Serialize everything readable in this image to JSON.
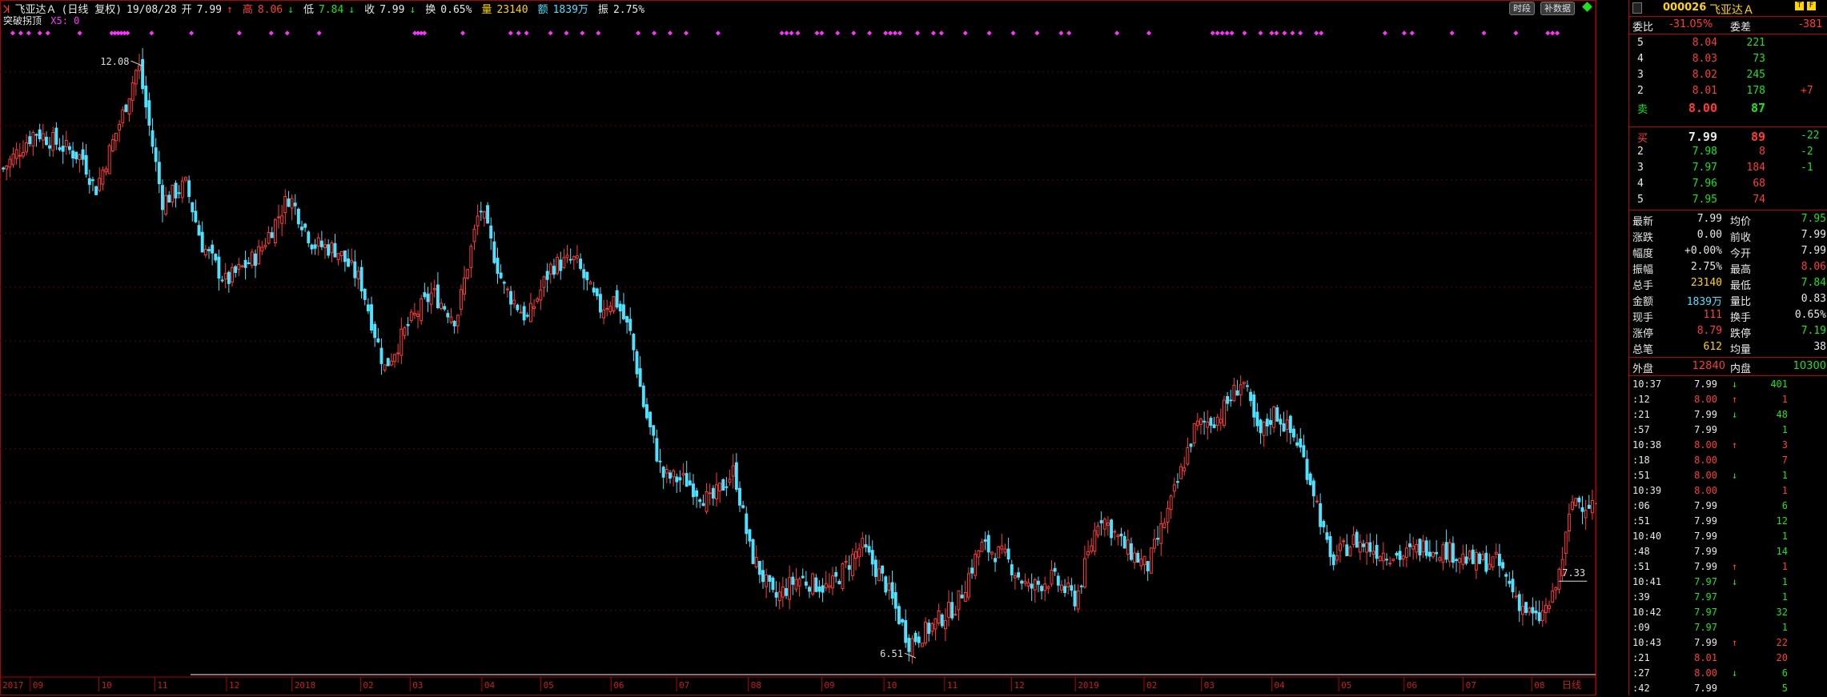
{
  "header": {
    "stock_name": "飞亚达Ａ",
    "period": "(日线 复权)",
    "date": "19/08/28",
    "open_label": "开",
    "open": "7.99",
    "open_arrow": "↑",
    "high_label": "高",
    "high": "8.06",
    "high_arrow": "↓",
    "low_label": "低",
    "low": "7.84",
    "low_arrow": "↓",
    "close_label": "收",
    "close": "7.99",
    "close_arrow": "↓",
    "turnover_label": "换",
    "turnover": "0.65%",
    "volume_label": "量",
    "volume": "23140",
    "amount_label": "额",
    "amount": "1839万",
    "amplitude_label": "振",
    "amplitude": "2.75%",
    "buttons": [
      "时段",
      "补数据"
    ],
    "indicator_name": "突破拐顶",
    "indicator_value": "X5: 0"
  },
  "chart_data": {
    "type": "candlestick",
    "y_ticks": [
      "12.00",
      "11.50",
      "11.00",
      "10.50",
      "10.00",
      "9.50",
      "9.00",
      "8.50",
      "8.00",
      "7.50",
      "7.00"
    ],
    "y_range": [
      6.44,
      12.4
    ],
    "x_ticks": [
      {
        "label": "2017",
        "x": 0
      },
      {
        "label": "09",
        "x": 0.019
      },
      {
        "label": "10",
        "x": 0.062
      },
      {
        "label": "11",
        "x": 0.097
      },
      {
        "label": "12",
        "x": 0.142
      },
      {
        "label": "2018",
        "x": 0.183
      },
      {
        "label": "02",
        "x": 0.226
      },
      {
        "label": "03",
        "x": 0.257
      },
      {
        "label": "04",
        "x": 0.302
      },
      {
        "label": "05",
        "x": 0.339
      },
      {
        "label": "06",
        "x": 0.383
      },
      {
        "label": "07",
        "x": 0.424
      },
      {
        "label": "08",
        "x": 0.469
      },
      {
        "label": "09",
        "x": 0.515
      },
      {
        "label": "10",
        "x": 0.554
      },
      {
        "label": "11",
        "x": 0.592
      },
      {
        "label": "12",
        "x": 0.634
      },
      {
        "label": "2019",
        "x": 0.674
      },
      {
        "label": "02",
        "x": 0.717
      },
      {
        "label": "03",
        "x": 0.753
      },
      {
        "label": "04",
        "x": 0.797
      },
      {
        "label": "05",
        "x": 0.839
      },
      {
        "label": "06",
        "x": 0.88
      },
      {
        "label": "07",
        "x": 0.917
      },
      {
        "label": "08",
        "x": 0.96
      }
    ],
    "x_axis_right_label": "日线",
    "anchors": [
      {
        "x": 0,
        "y": 11.1
      },
      {
        "x": 0.02,
        "y": 11.45
      },
      {
        "x": 0.05,
        "y": 11.2
      },
      {
        "x": 0.058,
        "y": 10.9
      },
      {
        "x": 0.075,
        "y": 11.6
      },
      {
        "x": 0.085,
        "y": 12.08
      },
      {
        "x": 0.093,
        "y": 11.4
      },
      {
        "x": 0.1,
        "y": 10.8
      },
      {
        "x": 0.115,
        "y": 10.95
      },
      {
        "x": 0.125,
        "y": 10.4
      },
      {
        "x": 0.14,
        "y": 10.05
      },
      {
        "x": 0.16,
        "y": 10.3
      },
      {
        "x": 0.18,
        "y": 10.85
      },
      {
        "x": 0.195,
        "y": 10.4
      },
      {
        "x": 0.21,
        "y": 10.35
      },
      {
        "x": 0.225,
        "y": 10.05
      },
      {
        "x": 0.24,
        "y": 9.25
      },
      {
        "x": 0.255,
        "y": 9.65
      },
      {
        "x": 0.27,
        "y": 9.95
      },
      {
        "x": 0.285,
        "y": 9.7
      },
      {
        "x": 0.3,
        "y": 10.75
      },
      {
        "x": 0.315,
        "y": 10.0
      },
      {
        "x": 0.33,
        "y": 9.7
      },
      {
        "x": 0.345,
        "y": 10.2
      },
      {
        "x": 0.36,
        "y": 10.25
      },
      {
        "x": 0.375,
        "y": 9.8
      },
      {
        "x": 0.385,
        "y": 9.9
      },
      {
        "x": 0.395,
        "y": 9.55
      },
      {
        "x": 0.403,
        "y": 8.9
      },
      {
        "x": 0.415,
        "y": 8.25
      },
      {
        "x": 0.43,
        "y": 8.2
      },
      {
        "x": 0.445,
        "y": 8.0
      },
      {
        "x": 0.46,
        "y": 8.3
      },
      {
        "x": 0.47,
        "y": 7.55
      },
      {
        "x": 0.485,
        "y": 7.1
      },
      {
        "x": 0.5,
        "y": 7.3
      },
      {
        "x": 0.52,
        "y": 7.2
      },
      {
        "x": 0.54,
        "y": 7.6
      },
      {
        "x": 0.555,
        "y": 7.25
      },
      {
        "x": 0.57,
        "y": 6.7
      },
      {
        "x": 0.58,
        "y": 6.8
      },
      {
        "x": 0.6,
        "y": 7.05
      },
      {
        "x": 0.615,
        "y": 7.6
      },
      {
        "x": 0.63,
        "y": 7.5
      },
      {
        "x": 0.645,
        "y": 7.2
      },
      {
        "x": 0.66,
        "y": 7.3
      },
      {
        "x": 0.675,
        "y": 7.1
      },
      {
        "x": 0.69,
        "y": 7.9
      },
      {
        "x": 0.705,
        "y": 7.6
      },
      {
        "x": 0.72,
        "y": 7.4
      },
      {
        "x": 0.735,
        "y": 8.0
      },
      {
        "x": 0.75,
        "y": 8.7
      },
      {
        "x": 0.765,
        "y": 8.8
      },
      {
        "x": 0.78,
        "y": 9.15
      },
      {
        "x": 0.79,
        "y": 8.6
      },
      {
        "x": 0.8,
        "y": 8.85
      },
      {
        "x": 0.815,
        "y": 8.55
      },
      {
        "x": 0.825,
        "y": 8.1
      },
      {
        "x": 0.835,
        "y": 7.45
      },
      {
        "x": 0.85,
        "y": 7.65
      },
      {
        "x": 0.865,
        "y": 7.55
      },
      {
        "x": 0.88,
        "y": 7.5
      },
      {
        "x": 0.895,
        "y": 7.6
      },
      {
        "x": 0.91,
        "y": 7.55
      },
      {
        "x": 0.925,
        "y": 7.45
      },
      {
        "x": 0.94,
        "y": 7.45
      },
      {
        "x": 0.955,
        "y": 7.05
      },
      {
        "x": 0.965,
        "y": 6.9
      },
      {
        "x": 0.975,
        "y": 7.1
      },
      {
        "x": 0.98,
        "y": 7.4
      },
      {
        "x": 0.988,
        "y": 8.05
      },
      {
        "x": 0.995,
        "y": 7.99
      }
    ],
    "annotations": [
      {
        "text": "12.08",
        "x": 0.082,
        "y": 12.08,
        "align": "right"
      },
      {
        "text": "6.51",
        "x": 0.567,
        "y": 6.58,
        "align": "right"
      },
      {
        "text": "7.33",
        "x": 0.977,
        "y": 7.33,
        "align": "left"
      }
    ],
    "last_price_marker": "7.99",
    "signal_marks_x": [
      0.008,
      0.013,
      0.018,
      0.025,
      0.03,
      0.05,
      0.07,
      0.072,
      0.074,
      0.076,
      0.078,
      0.08,
      0.095,
      0.12,
      0.15,
      0.17,
      0.18,
      0.2,
      0.26,
      0.262,
      0.264,
      0.266,
      0.29,
      0.32,
      0.325,
      0.33,
      0.345,
      0.355,
      0.365,
      0.375,
      0.4,
      0.41,
      0.42,
      0.43,
      0.45,
      0.49,
      0.493,
      0.496,
      0.5,
      0.512,
      0.515,
      0.525,
      0.535,
      0.545,
      0.555,
      0.558,
      0.561,
      0.564,
      0.575,
      0.585,
      0.59,
      0.605,
      0.62,
      0.635,
      0.65,
      0.665,
      0.67,
      0.7,
      0.72,
      0.76,
      0.763,
      0.766,
      0.769,
      0.772,
      0.78,
      0.79,
      0.797,
      0.8,
      0.805,
      0.81,
      0.815,
      0.825,
      0.828,
      0.868,
      0.88,
      0.885,
      0.91,
      0.93,
      0.95,
      0.97,
      0.973,
      0.976
    ]
  },
  "panel": {
    "code": "000026",
    "name": "飞亚达Ａ",
    "weibi_label": "委比",
    "weibi": "-31.05%",
    "weicha_label": "委差",
    "weicha": "-381",
    "asks": [
      {
        "level": "5",
        "price": "8.04",
        "vol": "221",
        "chg": ""
      },
      {
        "level": "4",
        "price": "8.03",
        "vol": "73",
        "chg": ""
      },
      {
        "level": "3",
        "price": "8.02",
        "vol": "245",
        "chg": ""
      },
      {
        "level": "2",
        "price": "8.01",
        "vol": "178",
        "chg": "+7"
      },
      {
        "level": "卖",
        "price": "8.00",
        "vol": "87",
        "chg": ""
      }
    ],
    "bids": [
      {
        "level": "买",
        "price": "7.99",
        "vol": "89",
        "chg": "-22"
      },
      {
        "level": "2",
        "price": "7.98",
        "vol": "8",
        "chg": "-2"
      },
      {
        "level": "3",
        "price": "7.97",
        "vol": "184",
        "chg": "-1"
      },
      {
        "level": "4",
        "price": "7.96",
        "vol": "68",
        "chg": ""
      },
      {
        "level": "5",
        "price": "7.95",
        "vol": "74",
        "chg": ""
      }
    ],
    "stats": [
      {
        "l1": "最新",
        "v1": "7.99",
        "c1": "white",
        "l2": "均价",
        "v2": "7.95",
        "c2": "green"
      },
      {
        "l1": "涨跌",
        "v1": "0.00",
        "c1": "white",
        "l2": "前收",
        "v2": "7.99",
        "c2": "white"
      },
      {
        "l1": "幅度",
        "v1": "+0.00%",
        "c1": "white",
        "l2": "今开",
        "v2": "7.99",
        "c2": "white"
      },
      {
        "l1": "振幅",
        "v1": "2.75%",
        "c1": "white",
        "l2": "最高",
        "v2": "8.06",
        "c2": "red"
      },
      {
        "l1": "总手",
        "v1": "23140",
        "c1": "yellow",
        "l2": "最低",
        "v2": "7.84",
        "c2": "green"
      },
      {
        "l1": "金额",
        "v1": "1839万",
        "c1": "cyan",
        "l2": "量比",
        "v2": "0.83",
        "c2": "white"
      },
      {
        "l1": "现手",
        "v1": "111",
        "c1": "red",
        "l2": "换手",
        "v2": "0.65%",
        "c2": "white"
      },
      {
        "l1": "涨停",
        "v1": "8.79",
        "c1": "red",
        "l2": "跌停",
        "v2": "7.19",
        "c2": "green"
      },
      {
        "l1": "总笔",
        "v1": "612",
        "c1": "yellow",
        "l2": "均量",
        "v2": "38",
        "c2": "white"
      }
    ],
    "outer_label": "外盘",
    "outer": "12840",
    "inner_label": "内盘",
    "inner": "10300",
    "ticks": [
      {
        "t": "10:37",
        "p": "7.99",
        "pc": "white",
        "a": "↓",
        "ac": "green",
        "v": "401",
        "vc": "green"
      },
      {
        "t": ":12",
        "p": "8.00",
        "pc": "red",
        "a": "↑",
        "ac": "red",
        "v": "1",
        "vc": "red"
      },
      {
        "t": ":21",
        "p": "7.99",
        "pc": "white",
        "a": "↓",
        "ac": "green",
        "v": "48",
        "vc": "green"
      },
      {
        "t": ":57",
        "p": "7.99",
        "pc": "white",
        "a": "",
        "ac": "white",
        "v": "1",
        "vc": "green"
      },
      {
        "t": "10:38",
        "p": "8.00",
        "pc": "red",
        "a": "↑",
        "ac": "red",
        "v": "3",
        "vc": "red"
      },
      {
        "t": ":18",
        "p": "8.00",
        "pc": "red",
        "a": "",
        "ac": "white",
        "v": "7",
        "vc": "red"
      },
      {
        "t": ":51",
        "p": "8.00",
        "pc": "red",
        "a": "↓",
        "ac": "green",
        "v": "1",
        "vc": "green"
      },
      {
        "t": "10:39",
        "p": "8.00",
        "pc": "red",
        "a": "",
        "ac": "white",
        "v": "1",
        "vc": "red"
      },
      {
        "t": ":06",
        "p": "7.99",
        "pc": "white",
        "a": "",
        "ac": "white",
        "v": "6",
        "vc": "green"
      },
      {
        "t": ":51",
        "p": "7.99",
        "pc": "white",
        "a": "",
        "ac": "white",
        "v": "12",
        "vc": "green"
      },
      {
        "t": "10:40",
        "p": "7.99",
        "pc": "white",
        "a": "",
        "ac": "white",
        "v": "1",
        "vc": "green"
      },
      {
        "t": ":48",
        "p": "7.99",
        "pc": "white",
        "a": "",
        "ac": "white",
        "v": "14",
        "vc": "green"
      },
      {
        "t": ":51",
        "p": "7.99",
        "pc": "white",
        "a": "↑",
        "ac": "red",
        "v": "1",
        "vc": "red"
      },
      {
        "t": "10:41",
        "p": "7.97",
        "pc": "green",
        "a": "↓",
        "ac": "green",
        "v": "1",
        "vc": "green"
      },
      {
        "t": ":39",
        "p": "7.97",
        "pc": "green",
        "a": "",
        "ac": "white",
        "v": "1",
        "vc": "green"
      },
      {
        "t": "10:42",
        "p": "7.97",
        "pc": "green",
        "a": "",
        "ac": "white",
        "v": "32",
        "vc": "green"
      },
      {
        "t": ":09",
        "p": "7.97",
        "pc": "green",
        "a": "",
        "ac": "white",
        "v": "1",
        "vc": "green"
      },
      {
        "t": "10:43",
        "p": "7.99",
        "pc": "white",
        "a": "↑",
        "ac": "red",
        "v": "22",
        "vc": "red"
      },
      {
        "t": ":21",
        "p": "8.01",
        "pc": "red",
        "a": "",
        "ac": "white",
        "v": "20",
        "vc": "red"
      },
      {
        "t": ":27",
        "p": "8.00",
        "pc": "red",
        "a": "↓",
        "ac": "green",
        "v": "6",
        "vc": "green"
      },
      {
        "t": ":42",
        "p": "7.99",
        "pc": "white",
        "a": "",
        "ac": "white",
        "v": "5",
        "vc": "green"
      }
    ]
  },
  "colors": {
    "up": "#ff3b3b",
    "down": "#4fe2ff",
    "border": "#b00000",
    "grid": "#5a0000",
    "signal": "#ff33ff",
    "axis_text": "#c02020"
  }
}
